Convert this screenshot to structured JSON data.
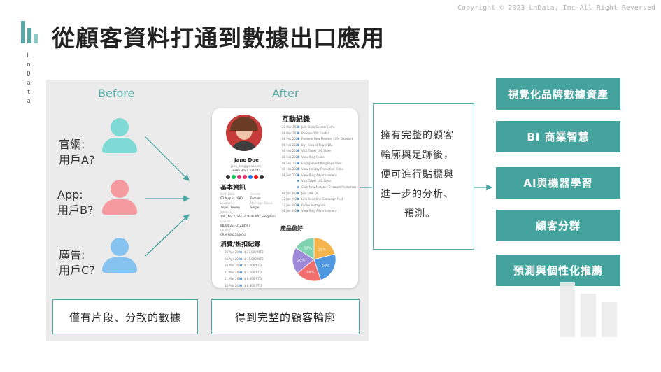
{
  "copyright": "Copyright © 2023 LnData, Inc-All Right Reversed",
  "brand": {
    "letters": [
      "L",
      "n",
      "D",
      "a",
      "t",
      "a"
    ]
  },
  "title": "從顧客資料打通到數據出口應用",
  "before_label": "Before",
  "after_label": "After",
  "users": [
    {
      "line1": "官網:",
      "line2": "用戶A?",
      "color": "#7fd9d4"
    },
    {
      "line1": "App:",
      "line2": "用戶B?",
      "color": "#f59a9e"
    },
    {
      "line1": "廣告:",
      "line2": "用戶C?",
      "color": "#86c3f0"
    }
  ],
  "profile": {
    "name": "Jane Doe",
    "email": "jane_doe@gmail.com",
    "phone": "+886 9191 300 144",
    "section_basic": "基本資訊",
    "section_interaction": "互動紀錄",
    "section_consumption": "消費/折扣紀錄",
    "section_preference": "產品偏好",
    "basic_fields": [
      {
        "label": "Birth Date",
        "value": "03 August 1990"
      },
      {
        "label": "Gender",
        "value": "Female"
      },
      {
        "label": "Location",
        "value": "Taipei, Taiwan"
      },
      {
        "label": "Marriage Status",
        "value": "Single"
      },
      {
        "label": "Address",
        "value": "10F., No. 2, Sec. 3, Bade Rd., Songshan"
      },
      {
        "label": "Line ID",
        "value": "BBA8C2EF-01234567"
      },
      {
        "label": "CRM ID",
        "value": "CRM-904234467tt"
      }
    ],
    "interactions": [
      {
        "date": "20 Mar 2023",
        "text": "Join Store Special Event"
      },
      {
        "date": "08 Mar 2023",
        "text": "Receive 100 Credits"
      },
      {
        "date": "08 Feb 2023",
        "text": "Redeem New Member 10% Discount"
      },
      {
        "date": "08 Feb 2023",
        "text": "Buy Ring at Taipei 101"
      },
      {
        "date": "08 Feb 2023",
        "text": "Visit Taipei 101 Store"
      },
      {
        "date": "08 Feb 2023",
        "text": "View Ring Guide"
      },
      {
        "date": "08 Feb 2023",
        "text": "Engagement Ring Page View"
      },
      {
        "date": "08 Feb 2023",
        "text": "View Holiday Promotion Video"
      },
      {
        "date": "08 Feb 2023",
        "text": "View Ring Advertisement"
      },
      {
        "date": "",
        "text": "Visit Taipei 101 Store"
      },
      {
        "date": "",
        "text": "Click New Member Discount Promotion"
      },
      {
        "date": "08 Jan 2023",
        "text": "Join LINE OA"
      },
      {
        "date": "12 Jan 2023",
        "text": "Line Valentine Campaign Post"
      },
      {
        "date": "12 Jan 2023",
        "text": "Follow Instagram"
      },
      {
        "date": "08 Jan 2023",
        "text": "View Ring Advertisement"
      }
    ],
    "purchases": [
      {
        "date": "20 Apr 2023",
        "amount": "$ 27,000 NTD"
      },
      {
        "date": "04 Apr 2023",
        "amount": "$ 15,000 NTD"
      },
      {
        "date": "28 Mar 2023",
        "amount": "$ 2,000 NTD"
      },
      {
        "date": "21 Mar 2023",
        "amount": "$ 3,500 NTD"
      },
      {
        "date": "21 Mar 2023",
        "amount": "$ 8,000 NTD"
      },
      {
        "date": "10 Feb 2023",
        "amount": "$ 8,800 NTD"
      }
    ],
    "pie": [
      {
        "value": 21,
        "color": "#f6b44c",
        "label": "21%"
      },
      {
        "value": 24,
        "color": "#4f97de",
        "label": "24%"
      },
      {
        "value": 19,
        "color": "#ef6f6c",
        "label": "19%"
      },
      {
        "value": 20,
        "color": "#9e88d8",
        "label": "20%"
      },
      {
        "value": 16,
        "color": "#7fd3b0",
        "label": "16%"
      }
    ]
  },
  "bottom_left": "僅有片段、分散的數據",
  "bottom_right": "得到完整的顧客輪廓",
  "description": [
    "擁有完整的顧客",
    "輪廓與足跡後，",
    "便可進行貼標與",
    "進一步的分析、",
    "預測。"
  ],
  "outputs": [
    "視覺化品牌數據資產",
    "BI 商業智慧",
    "AI與機器學習",
    "顧客分群",
    "預測與個性化推薦"
  ]
}
